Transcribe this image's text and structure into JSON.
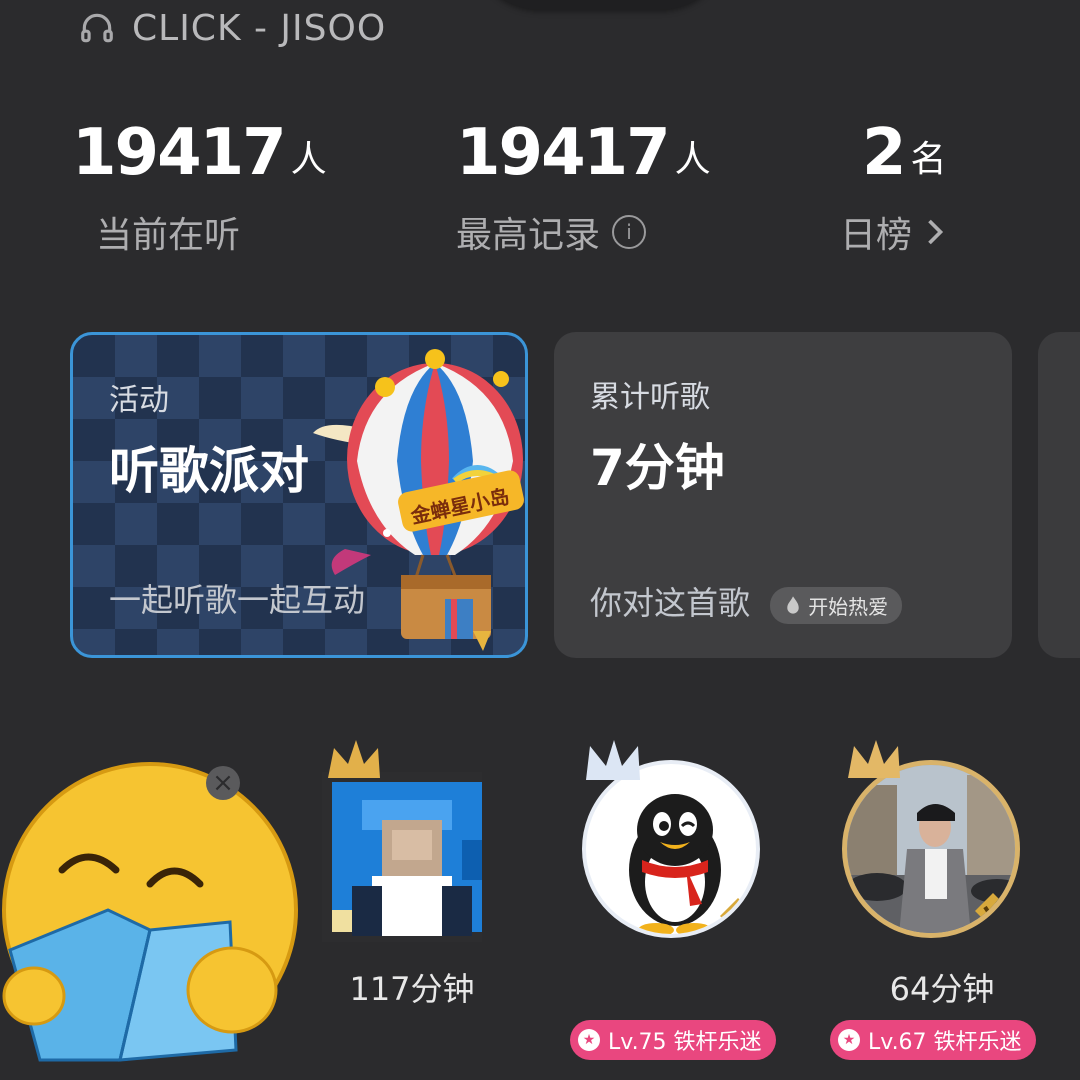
{
  "song": {
    "title": "CLICK - JISOO"
  },
  "stats": [
    {
      "value": "19417",
      "unit": "人",
      "label": "当前在听"
    },
    {
      "value": "19417",
      "unit": "人",
      "label": "最高记录"
    },
    {
      "value": "2",
      "unit": "名",
      "label": "日榜"
    }
  ],
  "cards": {
    "activity": {
      "kicker": "活动",
      "title": "听歌派对",
      "subtitle": "一起听歌一起互动",
      "balloon_text": "金蝉星小岛"
    },
    "listen": {
      "kicker": "累计听歌",
      "value": "7分钟",
      "footer": "你对这首歌",
      "badge": "开始热爱"
    }
  },
  "listeners": [
    {
      "minutes": "117分钟"
    },
    {
      "minutes": ""
    },
    {
      "minutes": "64分钟",
      "badge": "Lv.67 铁杆乐迷"
    }
  ],
  "listener_badge_2": "Lv.75 铁杆乐迷"
}
